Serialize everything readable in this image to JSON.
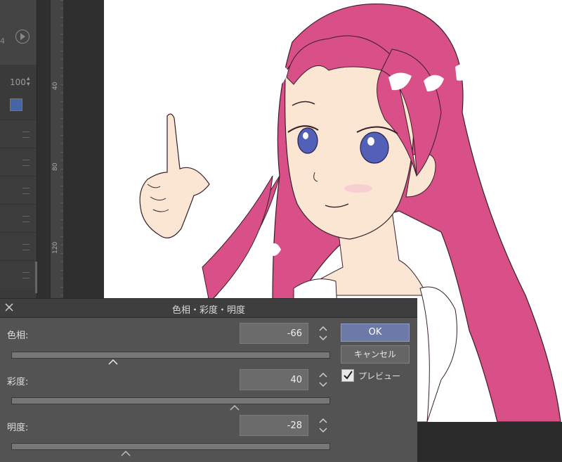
{
  "left_panel": {
    "edge_label": "4",
    "opacity_value": "100"
  },
  "ruler": {
    "marks": [
      "40",
      "80",
      "120"
    ]
  },
  "dialog": {
    "title": "色相・彩度・明度",
    "hue": {
      "label": "色相:",
      "value": "-66",
      "slider_fraction": 0.32
    },
    "saturation": {
      "label": "彩度:",
      "value": "40",
      "slider_fraction": 0.7
    },
    "lightness": {
      "label": "明度:",
      "value": "-28",
      "slider_fraction": 0.36
    },
    "ok_label": "OK",
    "cancel_label": "キャンセル",
    "preview_label": "プレビュー",
    "preview_checked": true
  },
  "colors": {
    "hair": "#d94f87",
    "skin": "#fbe6d4",
    "ok_button": "#6d7aa8",
    "eye": "#5360b8"
  }
}
